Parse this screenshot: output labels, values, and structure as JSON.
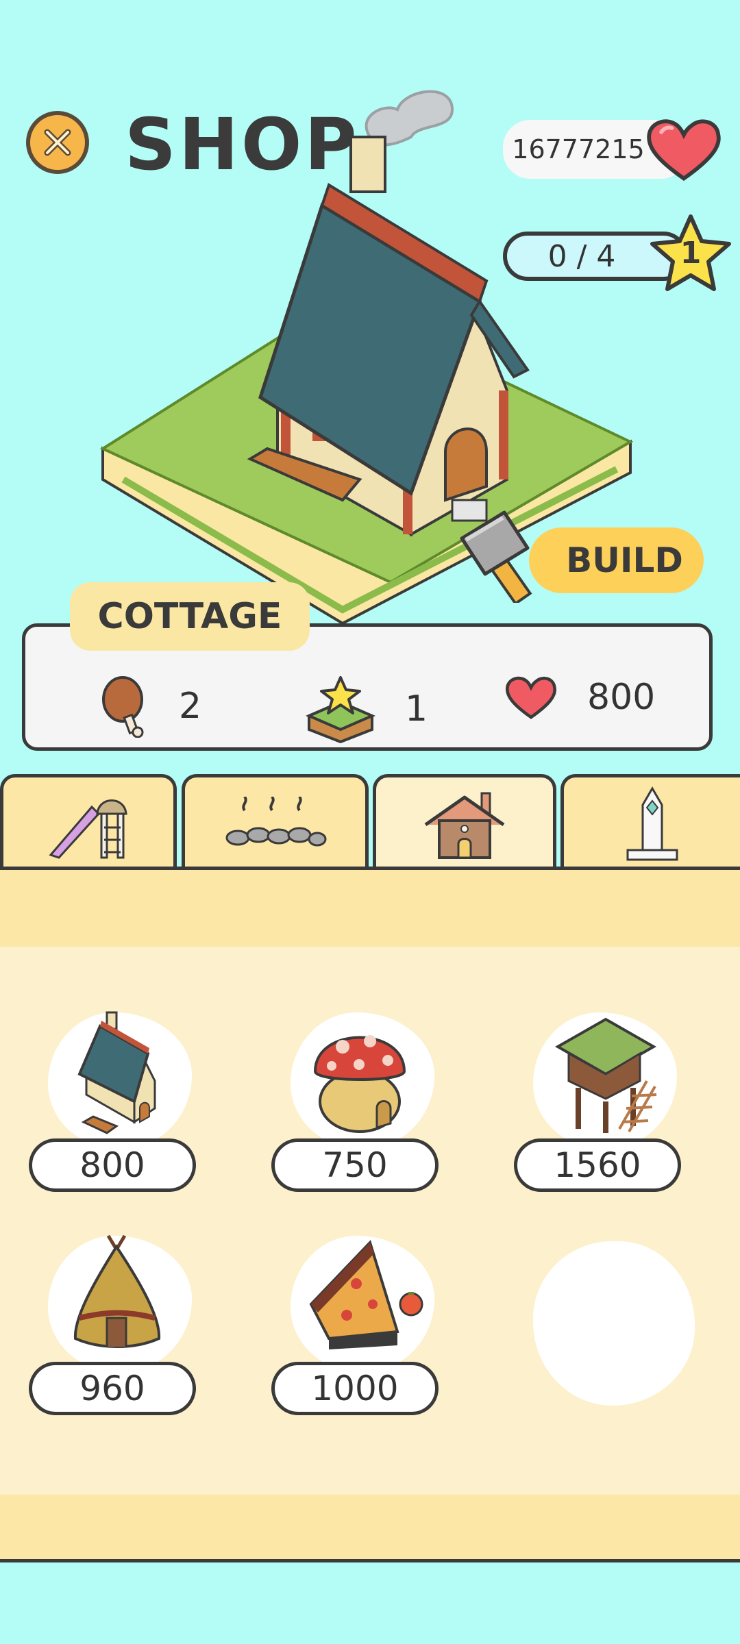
{
  "header": {
    "title": "SHOP",
    "coins": "16777215",
    "progress": "0 / 4",
    "level": "1"
  },
  "selected": {
    "name": "COTTAGE",
    "build_label": "BUILD",
    "stats": [
      {
        "icon": "meat-icon",
        "value": "2"
      },
      {
        "icon": "star-land-icon",
        "value": "1"
      },
      {
        "icon": "heart-icon",
        "value": "800"
      }
    ]
  },
  "tabs": [
    {
      "name": "playground",
      "icon": "slide-icon",
      "active": false
    },
    {
      "name": "hot-springs",
      "icon": "stones-icon",
      "active": false
    },
    {
      "name": "houses",
      "icon": "house-icon",
      "active": true
    },
    {
      "name": "monuments",
      "icon": "obelisk-icon",
      "active": false
    }
  ],
  "items": [
    {
      "icon": "cottage-icon",
      "price": "800"
    },
    {
      "icon": "mushroom-house-icon",
      "price": "750"
    },
    {
      "icon": "stilt-hut-icon",
      "price": "1560"
    },
    {
      "icon": "teepee-icon",
      "price": "960"
    },
    {
      "icon": "pizza-house-icon",
      "price": "1000"
    }
  ],
  "colors": {
    "background": "#b4fdf6",
    "accent": "#fdd05a",
    "panel": "#fde7a6",
    "heart": "#f05a63"
  }
}
